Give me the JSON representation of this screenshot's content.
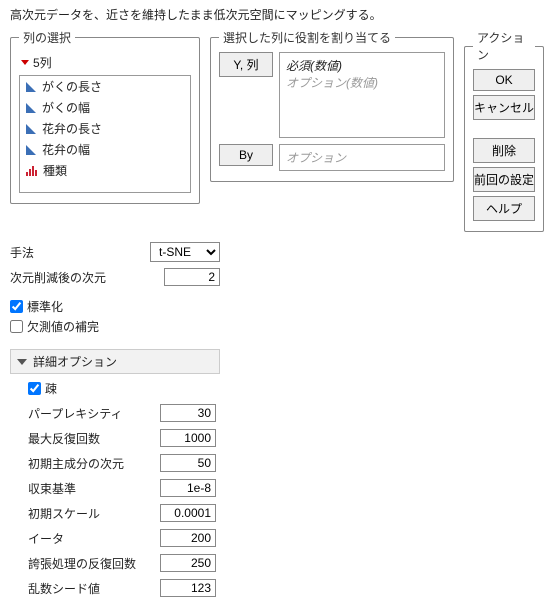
{
  "description": "高次元データを、近さを維持したまま低次元空間にマッピングする。",
  "col_select": {
    "legend": "列の選択",
    "count_label": "5列",
    "items": [
      {
        "label": "がくの長さ",
        "icon": "blue"
      },
      {
        "label": "がくの幅",
        "icon": "blue"
      },
      {
        "label": "花弁の長さ",
        "icon": "blue"
      },
      {
        "label": "花弁の幅",
        "icon": "blue"
      },
      {
        "label": "種類",
        "icon": "red"
      }
    ]
  },
  "roles": {
    "legend": "選択した列に役割を割り当てる",
    "y_button": "Y, 列",
    "y_required": "必須(数値)",
    "y_optional": "オプション(数値)",
    "by_button": "By",
    "by_optional": "オプション"
  },
  "actions": {
    "legend": "アクション",
    "ok": "OK",
    "cancel": "キャンセル",
    "delete": "削除",
    "prev": "前回の設定",
    "help": "ヘルプ"
  },
  "params": {
    "method_label": "手法",
    "method_value": "t-SNE",
    "dim_label": "次元削減後の次元",
    "dim_value": "2",
    "standardize_label": "標準化",
    "standardize_checked": true,
    "impute_label": "欠測値の補完",
    "impute_checked": false
  },
  "advanced": {
    "header": "詳細オプション",
    "fast_label": "疎",
    "fast_checked": true,
    "rows": [
      {
        "label": "パープレキシティ",
        "value": "30"
      },
      {
        "label": "最大反復回数",
        "value": "1000"
      },
      {
        "label": "初期主成分の次元",
        "value": "50"
      },
      {
        "label": "収束基準",
        "value": "1e-8"
      },
      {
        "label": "初期スケール",
        "value": "0.0001"
      },
      {
        "label": "イータ",
        "value": "200"
      },
      {
        "label": "誇張処理の反復回数",
        "value": "250"
      },
      {
        "label": "乱数シード値",
        "value": "123"
      }
    ]
  }
}
